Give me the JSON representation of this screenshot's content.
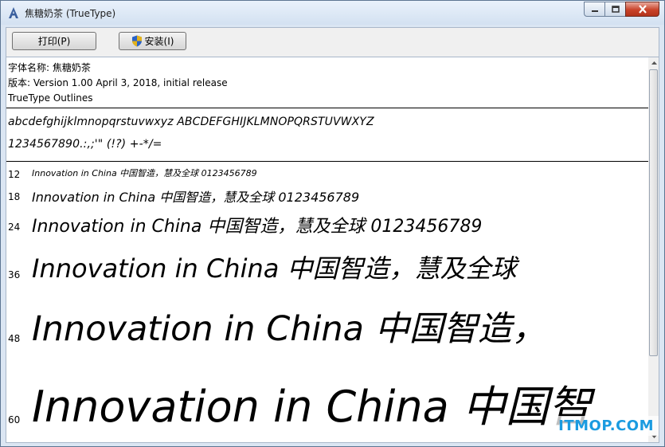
{
  "window": {
    "title": "焦糖奶茶 (TrueType)",
    "icon": "font-app-icon"
  },
  "toolbar": {
    "print_label": "打印(P)",
    "install_label": "安装(I)"
  },
  "font_info": {
    "name_line": "字体名称: 焦糖奶茶",
    "version_line": "版本: Version 1.00 April 3, 2018, initial release",
    "outline_line": "TrueType Outlines"
  },
  "charset": {
    "line1": "abcdefghijklmnopqrstuvwxyz ABCDEFGHIJKLMNOPQRSTUVWXYZ",
    "line2": "1234567890.:,;'\" (!?) +-*/="
  },
  "samples": [
    {
      "size": "12",
      "text": "Innovation in China 中国智造，慧及全球 0123456789"
    },
    {
      "size": "18",
      "text": "Innovation in China 中国智造，慧及全球 0123456789"
    },
    {
      "size": "24",
      "text": "Innovation in China 中国智造，慧及全球 0123456789"
    },
    {
      "size": "36",
      "text": "Innovation in China 中国智造，慧及全球"
    },
    {
      "size": "48",
      "text": "Innovation in China 中国智造，"
    },
    {
      "size": "60",
      "text": "Innovation in China 中国智"
    }
  ],
  "watermark": "ITMOP.COM",
  "colors": {
    "accent": "#1a9be0",
    "close_button": "#c9432a"
  }
}
